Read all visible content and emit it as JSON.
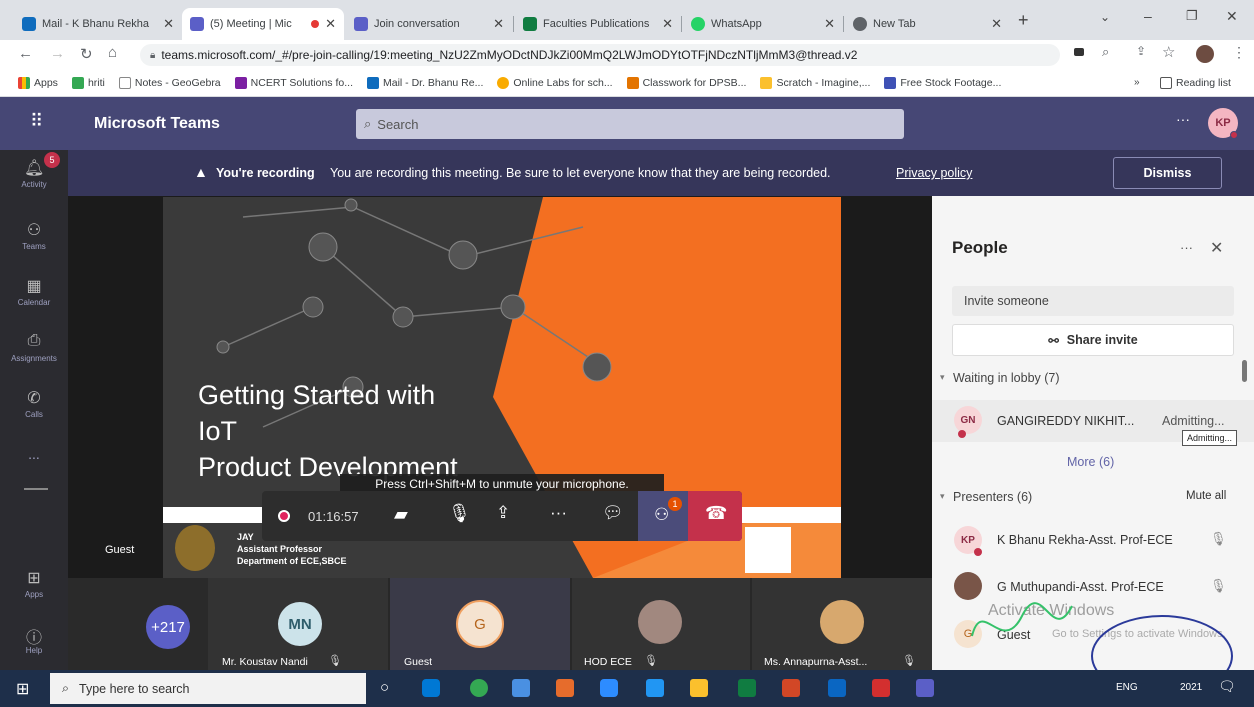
{
  "browser": {
    "tabs": [
      {
        "title": "Mail - K Bhanu Rekha",
        "color": "#0f6cbd"
      },
      {
        "title": "(5) Meeting | Mic",
        "color": "#5b5fc7",
        "active": true
      },
      {
        "title": "Join conversation",
        "color": "#5b5fc7"
      },
      {
        "title": "Faculties Publications",
        "color": "#107c41"
      },
      {
        "title": "WhatsApp",
        "color": "#25d366"
      },
      {
        "title": "New Tab",
        "color": "#5f6368"
      }
    ],
    "url": "teams.microsoft.com/_#/pre-join-calling/19:meeting_NzU2ZmMyODctNDJkZi00MmQ2LWJmODYtOTFjNDczNTljMmM3@thread.v2",
    "bookmarks": [
      "Apps",
      "hriti",
      "Notes - GeoGebra",
      "NCERT Solutions fo...",
      "Mail - Dr. Bhanu Re...",
      "Online Labs for sch...",
      "Classwork for DPSB...",
      "Scratch - Imagine,...",
      "Free Stock Footage..."
    ],
    "reading_list": "Reading list"
  },
  "teams": {
    "app_name": "Microsoft Teams",
    "search_placeholder": "Search",
    "avatar": "KP",
    "activity_badge": "5",
    "rail": [
      "Activity",
      "Teams",
      "Calendar",
      "Assignments",
      "Calls",
      "...",
      "Apps",
      "Help"
    ],
    "banner": {
      "bold": "You're recording",
      "text": "You are recording this meeting. Be sure to let everyone know that they are being recorded.",
      "link": "Privacy policy",
      "dismiss": "Dismiss"
    },
    "slide": {
      "title_line1": "Getting Started with",
      "title_line2": "IoT",
      "title_line3": "Product Development",
      "name": "JAY",
      "role": "Assistant Professor",
      "dept": "Department of ECE,SBCE"
    },
    "guest_label": "Guest",
    "tooltip": "Press Ctrl+Shift+M to unmute your microphone.",
    "timer": "01:16:57",
    "participants_badge": "1",
    "tiles": {
      "count": "+217",
      "mn_initials": "MN",
      "mn_name": "Mr. Koustav Nandi",
      "g_initials": "G",
      "g_name": "Guest",
      "hod": "HOD ECE",
      "ann": "Ms. Annapurna-Asst..."
    },
    "people": {
      "title": "People",
      "invite": "Invite someone",
      "share": "Share invite",
      "lobby": "Waiting in lobby (7)",
      "lobby_person": {
        "initials": "GN",
        "name": "GANGIREDDY NIKHIT...",
        "status": "Admitting...",
        "tip": "Admitting..."
      },
      "more": "More (6)",
      "presenters": "Presenters (6)",
      "mute_all": "Mute all",
      "p1": {
        "initials": "KP",
        "name": "K Bhanu Rekha-Asst. Prof-ECE"
      },
      "p2": {
        "name": "G Muthupandi-Asst. Prof-ECE"
      },
      "p3": {
        "initials": "G",
        "name": "Guest"
      },
      "activate": "Activate Windows",
      "activate_sub": "Go to Settings to activate Windows."
    }
  },
  "taskbar": {
    "search": "Type here to search",
    "lang": "ENG",
    "time": "2021"
  }
}
